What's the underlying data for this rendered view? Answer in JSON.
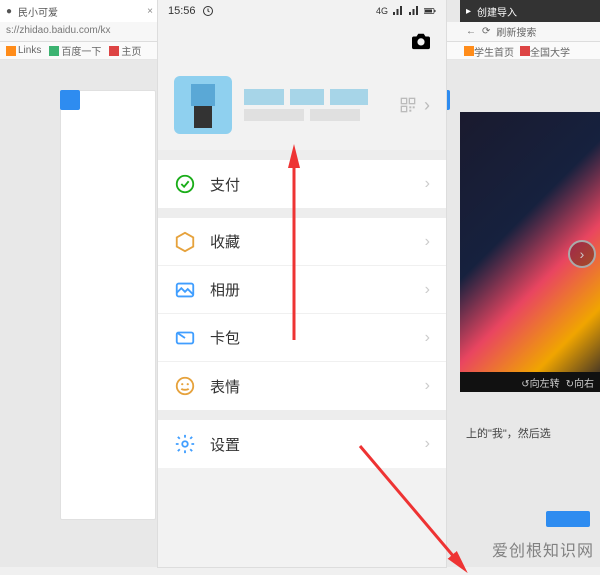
{
  "backdrop": {
    "tab_title": "民小可爱",
    "address": "s://zhidao.baidu.com/kx",
    "bookmarks": [
      "Links",
      "百度一下",
      "主页"
    ],
    "right_tab": "创建导入",
    "refresh_label": "刷新搜索",
    "right_bookmarks": [
      "学生首页",
      "全国大学"
    ],
    "video_rotate_left": "向左转",
    "video_rotate_right": "向右",
    "article_snippet": "上的\"我\"，然后选"
  },
  "statusbar": {
    "time": "15:56",
    "network": "4G"
  },
  "profile": {
    "qr_label": "qr"
  },
  "menu": {
    "pay": "支付",
    "favorites": "收藏",
    "album": "相册",
    "cards": "卡包",
    "stickers": "表情",
    "settings": "设置"
  },
  "watermark": "爱创根知识网"
}
